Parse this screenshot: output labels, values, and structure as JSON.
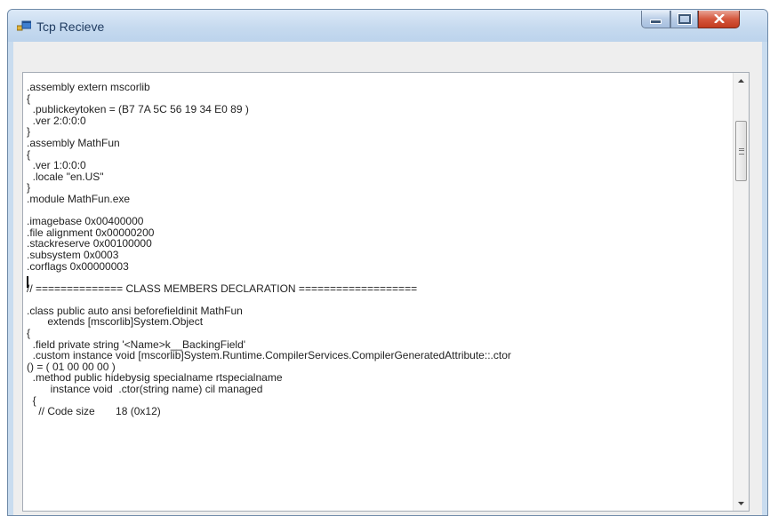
{
  "window": {
    "title": "Tcp Recieve",
    "controls": {
      "minimize": "minimize",
      "maximize": "maximize",
      "close": "close"
    }
  },
  "icons": {
    "app": "app-window-icon",
    "minimize": "minimize-icon",
    "maximize": "maximize-icon",
    "close": "close-icon",
    "scroll_up": "scroll-up-arrow-icon",
    "scroll_down": "scroll-down-arrow-icon"
  },
  "colors": {
    "titlebar": "#c6daef",
    "close_button": "#d5573d",
    "client_background": "#eeeeee",
    "textbox_background": "#ffffff"
  },
  "textbox": {
    "lines": [
      ".assembly extern mscorlib",
      "{",
      "  .publickeytoken = (B7 7A 5C 56 19 34 E0 89 )",
      "  .ver 2:0:0:0",
      "}",
      ".assembly MathFun",
      "{",
      "  .ver 1:0:0:0",
      "  .locale \"en.US\"",
      "}",
      ".module MathFun.exe",
      "",
      ".imagebase 0x00400000",
      ".file alignment 0x00000200",
      ".stackreserve 0x00100000",
      ".subsystem 0x0003",
      ".corflags 0x00000003",
      "",
      "// ============== CLASS MEMBERS DECLARATION ===================",
      "",
      ".class public auto ansi beforefieldinit MathFun",
      "       extends [mscorlib]System.Object",
      "{",
      "  .field private string '<Name>k__BackingField'",
      "  .custom instance void [mscorlib]System.Runtime.CompilerServices.CompilerGeneratedAttribute::.ctor",
      "() = ( 01 00 00 00 )",
      "  .method public hidebysig specialname rtspecialname",
      "        instance void  .ctor(string name) cil managed",
      "  {",
      "    // Code size       18 (0x12)"
    ]
  }
}
